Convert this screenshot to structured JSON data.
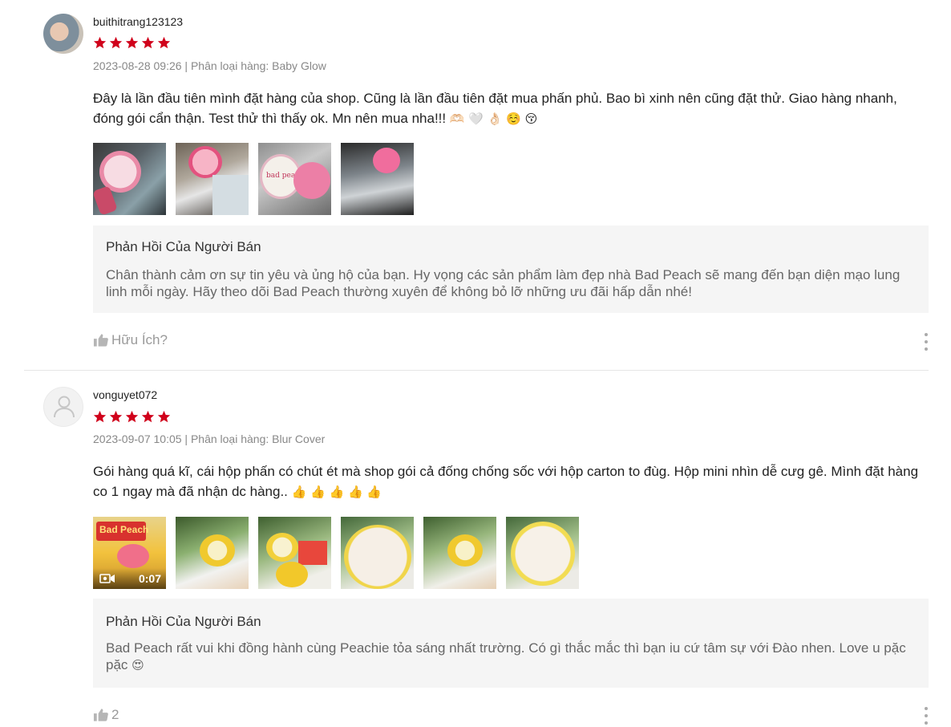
{
  "colors": {
    "star": "#d0011b",
    "reply_bg": "#f5f5f5",
    "meta_text": "#888888"
  },
  "reviews": [
    {
      "username": "buithitrang123123",
      "rating": 5,
      "meta": "2023-08-28 09:26 | Phân loại hàng: Baby Glow",
      "content": "Đây là lần đầu tiên mình đặt hàng của shop. Cũng là lần đầu tiên đặt mua phấn phủ. Bao bì xinh nên cũng đặt thử. Giao hàng nhanh, đóng gói cẩn thận. Test thử thì thấy ok. Mn nên mua nha!!!",
      "content_emojis": "🫶🏻 🤍 👌🏻 ☺️ 😚",
      "reply_title": "Phản Hồi Của Người Bán",
      "reply_text": "Chân thành cảm ơn sự tin yêu và ủng hộ của bạn. Hy vọng các sản phẩm làm đẹp nhà Bad Peach sẽ mang đến bạn diện mạo lung linh mỗi ngày. Hãy theo dõi Bad Peach thường xuyên để không bỏ lỡ những ưu đãi hấp dẫn nhé!",
      "helpful_label": "Hữu Ích?",
      "avatar_icon": "user-photo-avatar",
      "thumb_label": "bad peach"
    },
    {
      "username": "vonguyet072",
      "rating": 5,
      "meta": "2023-09-07 10:05 | Phân loại hàng: Blur Cover",
      "content": "Gói hàng quá kĩ, cái hộp phấn có chút ét mà shop gói cả đống chống sốc với hộp carton to đùg. Hộp mini nhìn dễ cưg gê. Mình đặt hàng co 1 ngay mà đã nhận dc hàng..",
      "content_emojis": "👍 👍 👍 👍 👍",
      "reply_title": "Phản Hồi Của Người Bán",
      "reply_text": "Bad Peach rất vui khi đồng hành cùng Peachie tỏa sáng nhất trường. Có gì thắc mắc thì bạn iu cứ tâm sự với Đào nhen. Love u pặc pặc",
      "reply_emoji": "😍",
      "helpful_label": "2",
      "video_duration": "0:07",
      "avatar_icon": "default-user-avatar",
      "thumb_label": "Bad Peach"
    }
  ]
}
